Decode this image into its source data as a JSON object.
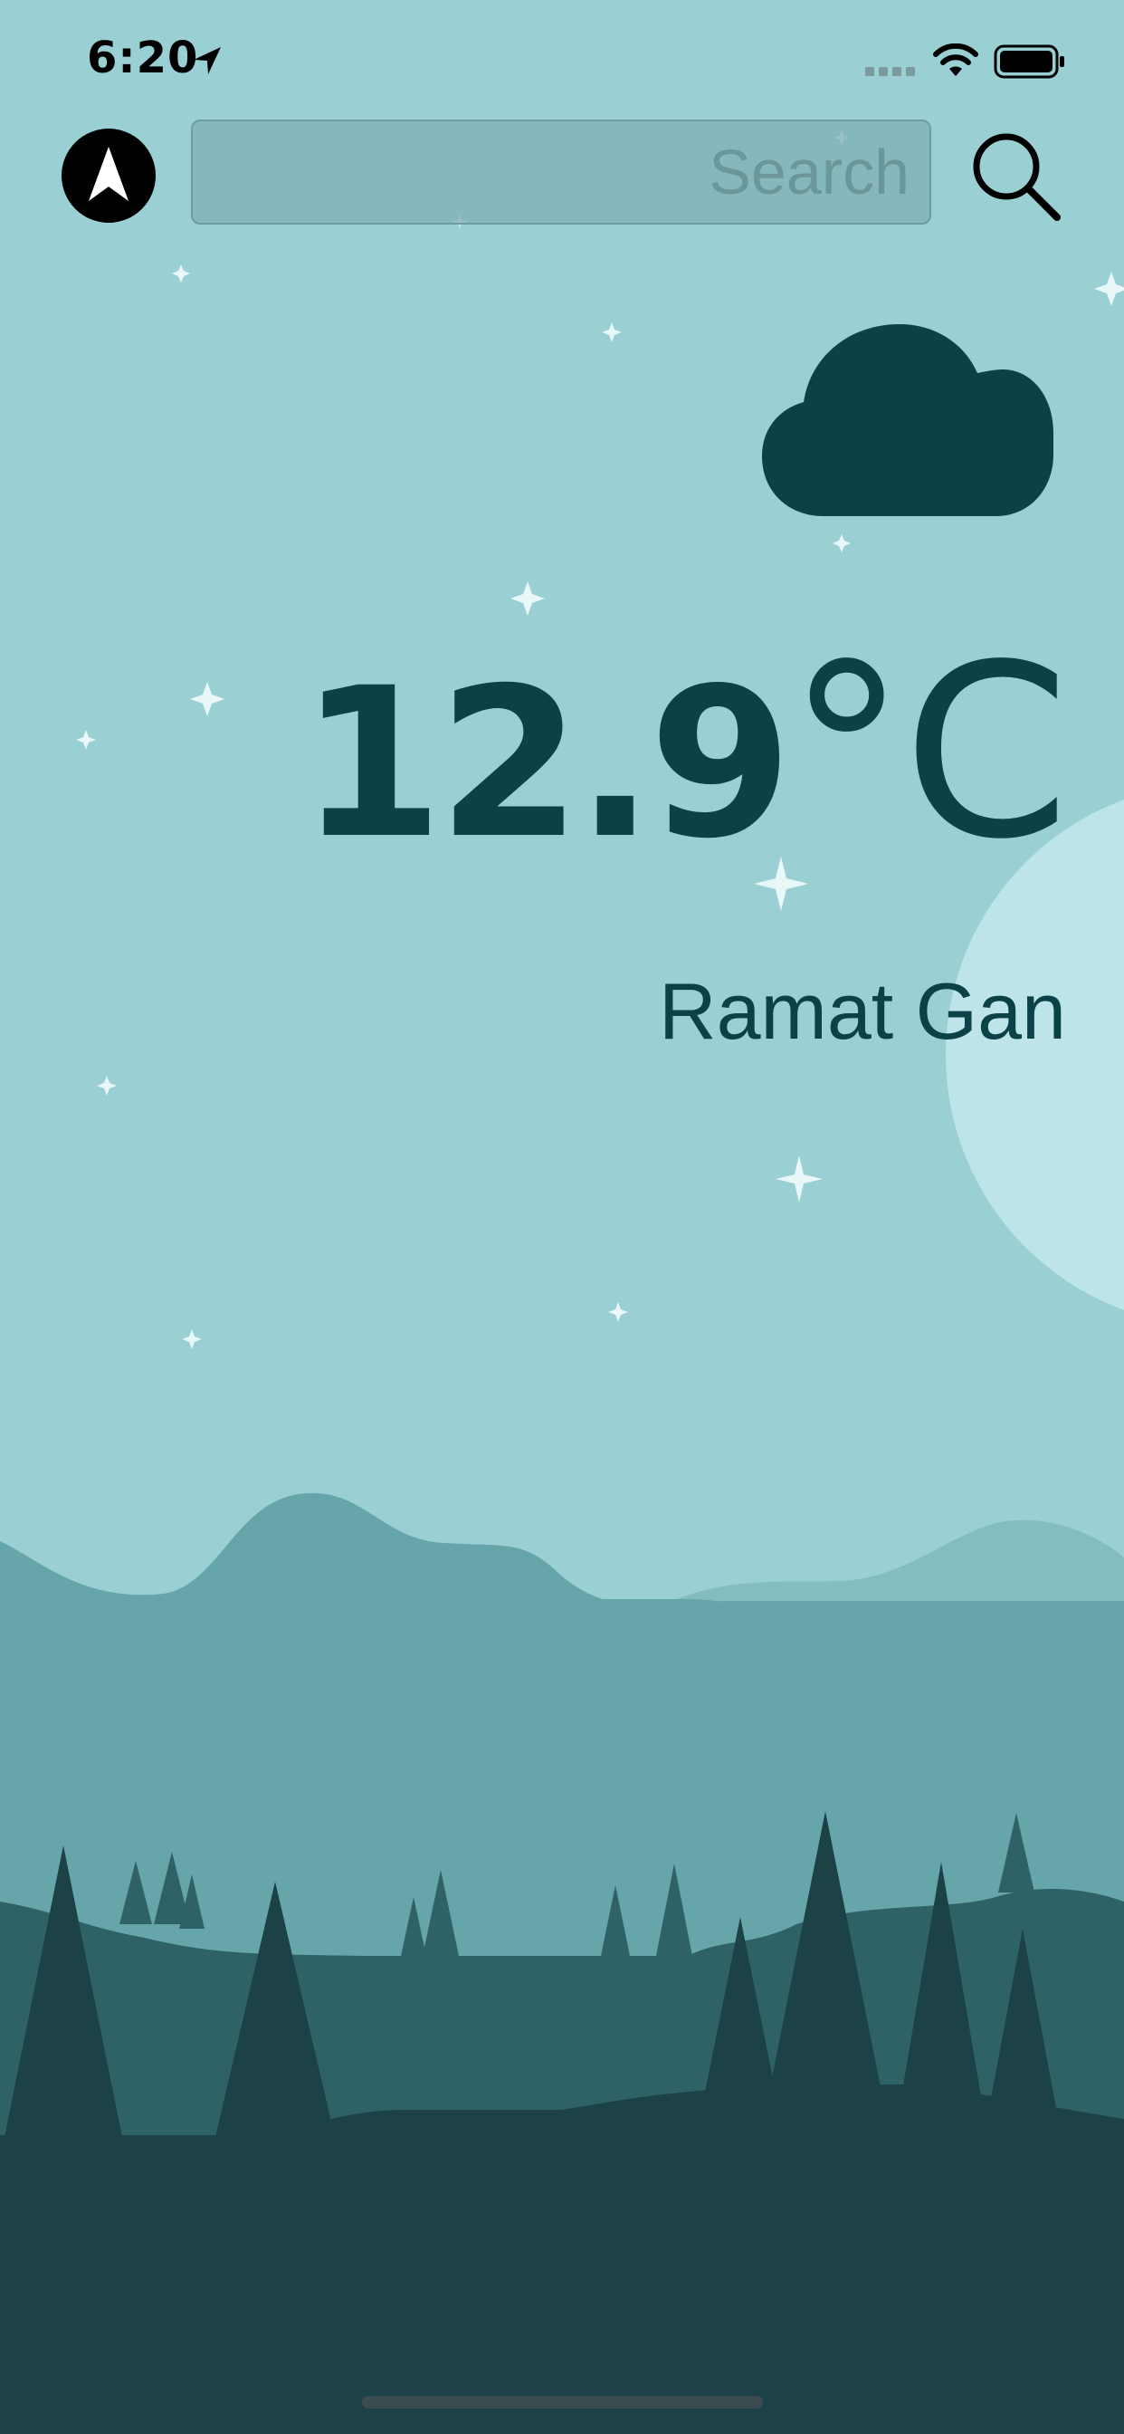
{
  "status_bar": {
    "time": "6:20",
    "icons": [
      "location-arrow-icon",
      "signal-icon",
      "wifi-icon",
      "battery-icon"
    ]
  },
  "header": {
    "location_icon": "navigation-arrow-icon",
    "search_placeholder": "Search",
    "search_value": "",
    "search_icon": "magnifier-icon"
  },
  "weather": {
    "condition_icon": "cloud-icon",
    "temperature": "12.9",
    "unit": "°C",
    "city": "Ramat Gan"
  },
  "colors": {
    "sky": "#9ad0d4",
    "accent": "#0a4248",
    "moon": "#bde4e8",
    "hills_far": "#83bdc1",
    "hills_mid": "#66a6aa",
    "hills_near": "#2f6266",
    "forest": "#1c4147"
  }
}
